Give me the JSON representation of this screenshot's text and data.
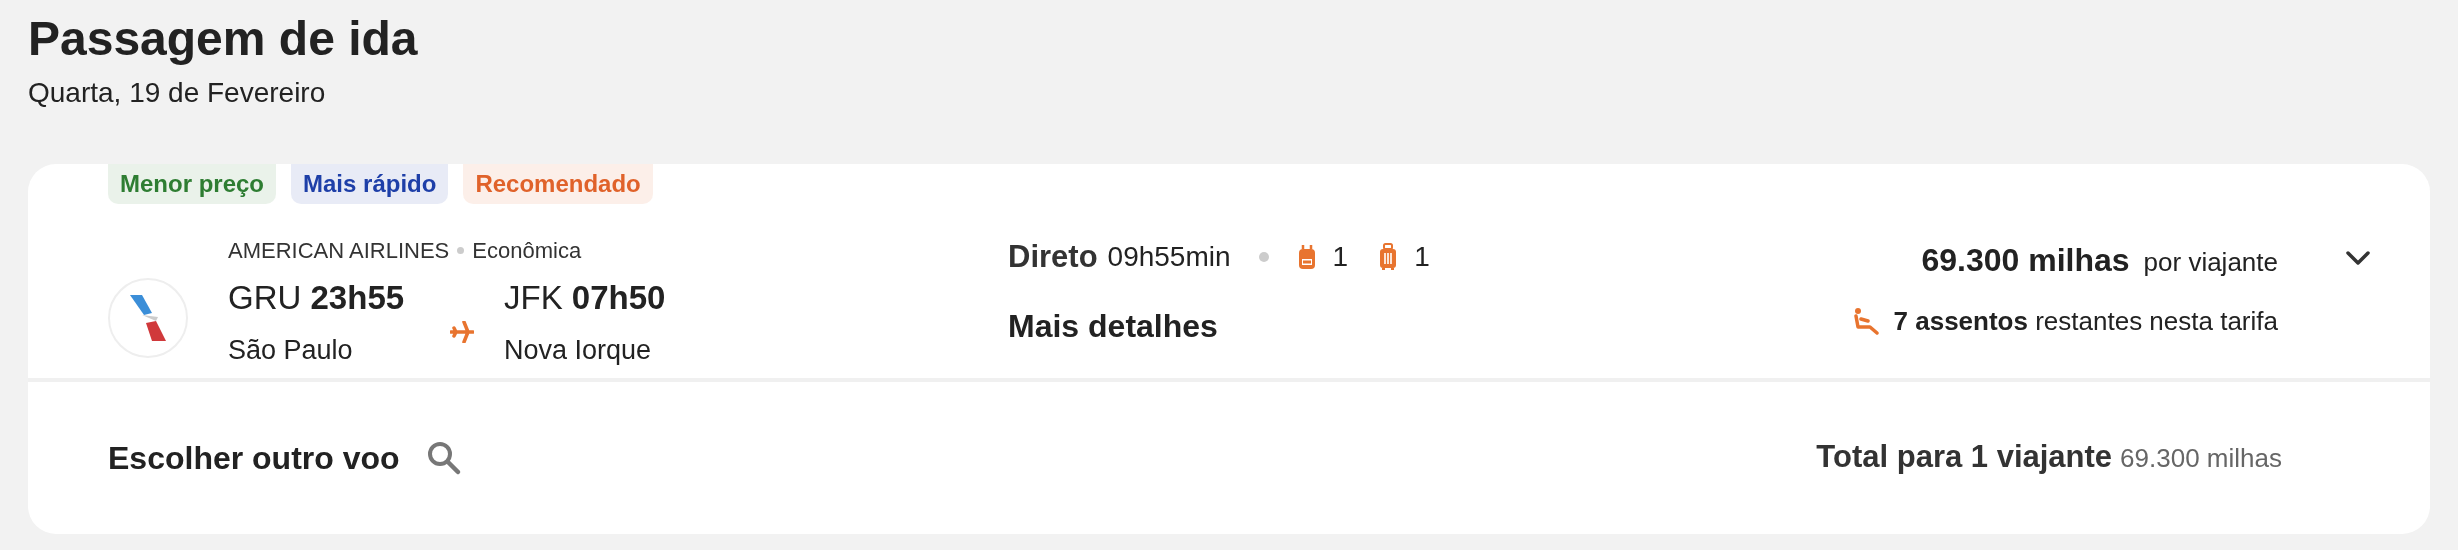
{
  "header": {
    "title": "Passagem de ida",
    "date": "Quarta, 19 de Fevereiro"
  },
  "badges": [
    {
      "label": "Menor preço",
      "color": "#2e7d32"
    },
    {
      "label": "Mais rápido",
      "color": "#1e3fa8"
    },
    {
      "label": "Recomendado",
      "color": "#e0622a"
    }
  ],
  "flight": {
    "airline": "AMERICAN AIRLINES",
    "cabin": "Econômica",
    "origin": {
      "code": "GRU",
      "time": "23h55",
      "city": "São Paulo"
    },
    "destination": {
      "code": "JFK",
      "time": "07h50",
      "city": "Nova Iorque"
    },
    "stops": "Direto",
    "duration": "09h55min",
    "bags": [
      {
        "kind": "backpack",
        "count": "1"
      },
      {
        "kind": "suitcase",
        "count": "1"
      }
    ],
    "details_link": "Mais detalhes",
    "price": "69.300 milhas",
    "price_unit": "por viajante",
    "seats_count": "7 assentos",
    "seats_text": "restantes nesta tarifa",
    "expanded": false
  },
  "footer": {
    "other_flight": "Escolher outro voo",
    "total_label": "Total para 1 viajante",
    "total_value": "69.300 milhas"
  }
}
